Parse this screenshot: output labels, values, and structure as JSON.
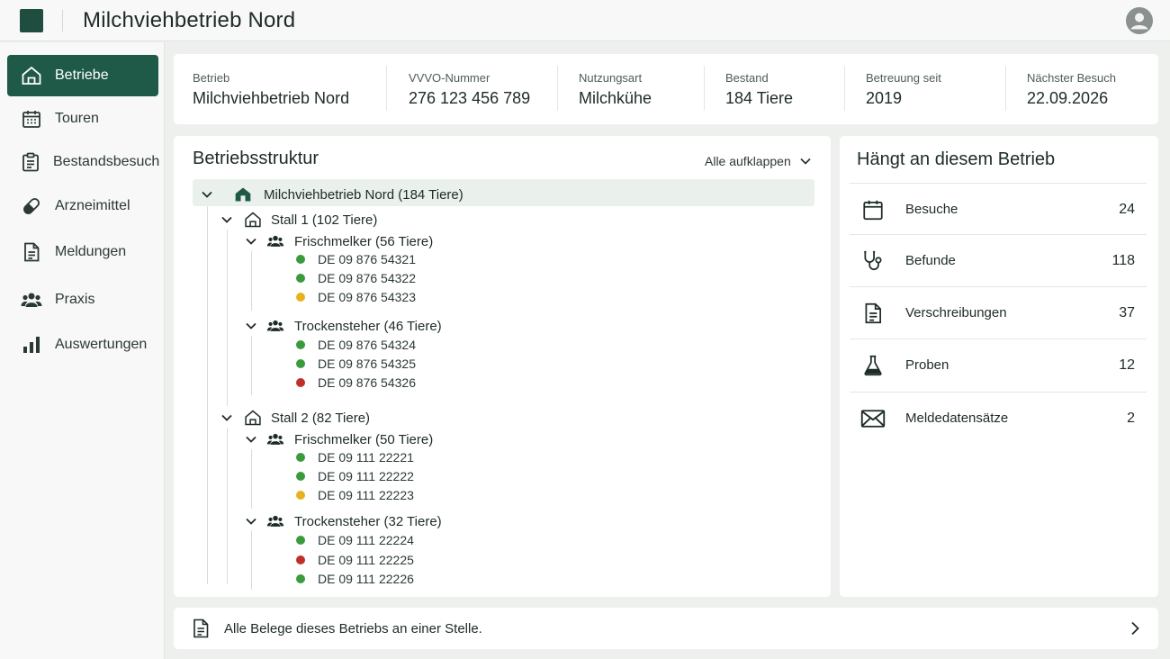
{
  "app": {
    "title": "Milchviehbetrieb Nord"
  },
  "sidebar": {
    "items": [
      {
        "label": "Betriebe",
        "icon": "barn-icon",
        "active": true
      },
      {
        "label": "Touren",
        "icon": "calendar-icon"
      },
      {
        "label": "Bestandsbesuch",
        "icon": "clipboard-icon"
      },
      {
        "label": "Arzneimittel",
        "icon": "pill-icon"
      },
      {
        "label": "Meldungen",
        "icon": "document-icon"
      },
      {
        "label": "Praxis",
        "icon": "people-icon"
      },
      {
        "label": "Auswertungen",
        "icon": "bar-chart-icon"
      }
    ]
  },
  "summary": {
    "betrieb": {
      "label": "Betrieb",
      "value": "Milchviehbetrieb Nord"
    },
    "vvvo": {
      "label": "VVVO-Nummer",
      "value": "276 123 456 789"
    },
    "nutzungsart": {
      "label": "Nutzungsart",
      "value": "Milchkühe"
    },
    "bestand": {
      "label": "Bestand",
      "value": "184 Tiere"
    },
    "betreuung": {
      "label": "Betreuung seit",
      "value": "2019"
    },
    "besuch": {
      "label": "Nächster Besuch",
      "value": "22.09.2026"
    }
  },
  "tree": {
    "title": "Betriebsstruktur",
    "expand_all": "Alle aufklappen",
    "root": "Milchviehbetrieb Nord (184 Tiere)",
    "stalls": [
      {
        "label": "Stall 1 (102 Tiere)",
        "groups": [
          {
            "label": "Frischmelker (56 Tiere)",
            "animals": [
              {
                "id": "DE 09 876 54321",
                "status": "green"
              },
              {
                "id": "DE 09 876 54322",
                "status": "green"
              },
              {
                "id": "DE 09 876 54323",
                "status": "yellow"
              }
            ]
          },
          {
            "label": "Trockensteher (46 Tiere)",
            "animals": [
              {
                "id": "DE 09 876 54324",
                "status": "green"
              },
              {
                "id": "DE 09 876 54325",
                "status": "green"
              },
              {
                "id": "DE 09 876 54326",
                "status": "red"
              }
            ]
          }
        ]
      },
      {
        "label": "Stall 2 (82 Tiere)",
        "groups": [
          {
            "label": "Frischmelker (50 Tiere)",
            "animals": [
              {
                "id": "DE 09 111 22221",
                "status": "green"
              },
              {
                "id": "DE 09 111 22222",
                "status": "green"
              },
              {
                "id": "DE 09 111 22223",
                "status": "yellow"
              }
            ]
          },
          {
            "label": "Trockensteher (32 Tiere)",
            "animals": [
              {
                "id": "DE 09 111 22224",
                "status": "green"
              },
              {
                "id": "DE 09 111 22225",
                "status": "red"
              },
              {
                "id": "DE 09 111 22226",
                "status": "green"
              }
            ]
          }
        ]
      }
    ]
  },
  "related": {
    "title": "Hängt an diesem Betrieb",
    "items": [
      {
        "label": "Besuche",
        "count": "24",
        "icon": "calendar-icon"
      },
      {
        "label": "Befunde",
        "count": "118",
        "icon": "stethoscope-icon"
      },
      {
        "label": "Verschreibungen",
        "count": "37",
        "icon": "document-icon"
      },
      {
        "label": "Proben",
        "count": "12",
        "icon": "flask-icon"
      },
      {
        "label": "Meldedatensätze",
        "count": "2",
        "icon": "envelope-icon"
      }
    ]
  },
  "footer": {
    "text": "Alle Belege dieses Betriebs an einer Stelle."
  },
  "colors": {
    "accent": "#1f5a48",
    "status_green": "#3c9a3e",
    "status_yellow": "#e8b21e",
    "status_red": "#c0302a"
  }
}
